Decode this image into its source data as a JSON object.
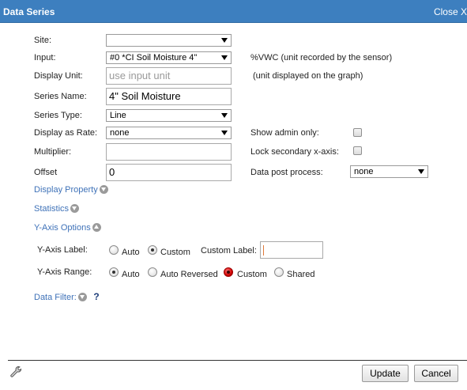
{
  "window": {
    "title": "Data Series",
    "close_label": "Close X"
  },
  "form": {
    "site": {
      "label": "Site:",
      "value": ""
    },
    "input": {
      "label": "Input:",
      "value": "#0 *CI Soil Moisture 4\"",
      "note": "%VWC (unit recorded by the sensor)"
    },
    "display_unit": {
      "label": "Display Unit:",
      "placeholder": "use input unit",
      "note": "(unit displayed on the graph)"
    },
    "series_name": {
      "label": "Series Name:",
      "value": "4\" Soil Moisture"
    },
    "series_type": {
      "label": "Series Type:",
      "value": "Line"
    },
    "display_as_rate": {
      "label": "Display as Rate:",
      "value": "none"
    },
    "multiplier": {
      "label": "Multiplier:",
      "value": ""
    },
    "offset": {
      "label": "Offset",
      "value": "0"
    },
    "show_admin_only": {
      "label": "Show admin only:",
      "checked": false
    },
    "lock_secondary_x": {
      "label": "Lock secondary x-axis:",
      "checked": false
    },
    "data_post_process": {
      "label": "Data post process:",
      "value": "none"
    }
  },
  "sections": {
    "display_property": "Display Property",
    "statistics": "Statistics",
    "y_axis_options": "Y-Axis Options",
    "data_filter": "Data Filter:"
  },
  "y_axis": {
    "label_title": "Y-Axis Label:",
    "label_options": [
      "Auto",
      "Custom"
    ],
    "label_selected": "Custom",
    "custom_label_title": "Custom Label:",
    "custom_label_value": "",
    "range_title": "Y-Axis Range:",
    "range_options": [
      "Auto",
      "Auto Reversed",
      "Custom",
      "Shared"
    ],
    "range_selected": "Auto"
  },
  "footer": {
    "update_label": "Update",
    "cancel_label": "Cancel"
  },
  "icons": {
    "close": "close-icon",
    "wrench": "wrench-icon",
    "help": "help-icon",
    "toggle": "chevron-icon"
  },
  "colors": {
    "titlebar": "#3d7fbf",
    "link": "#3f72b8",
    "highlight_radio": "#d10000"
  }
}
